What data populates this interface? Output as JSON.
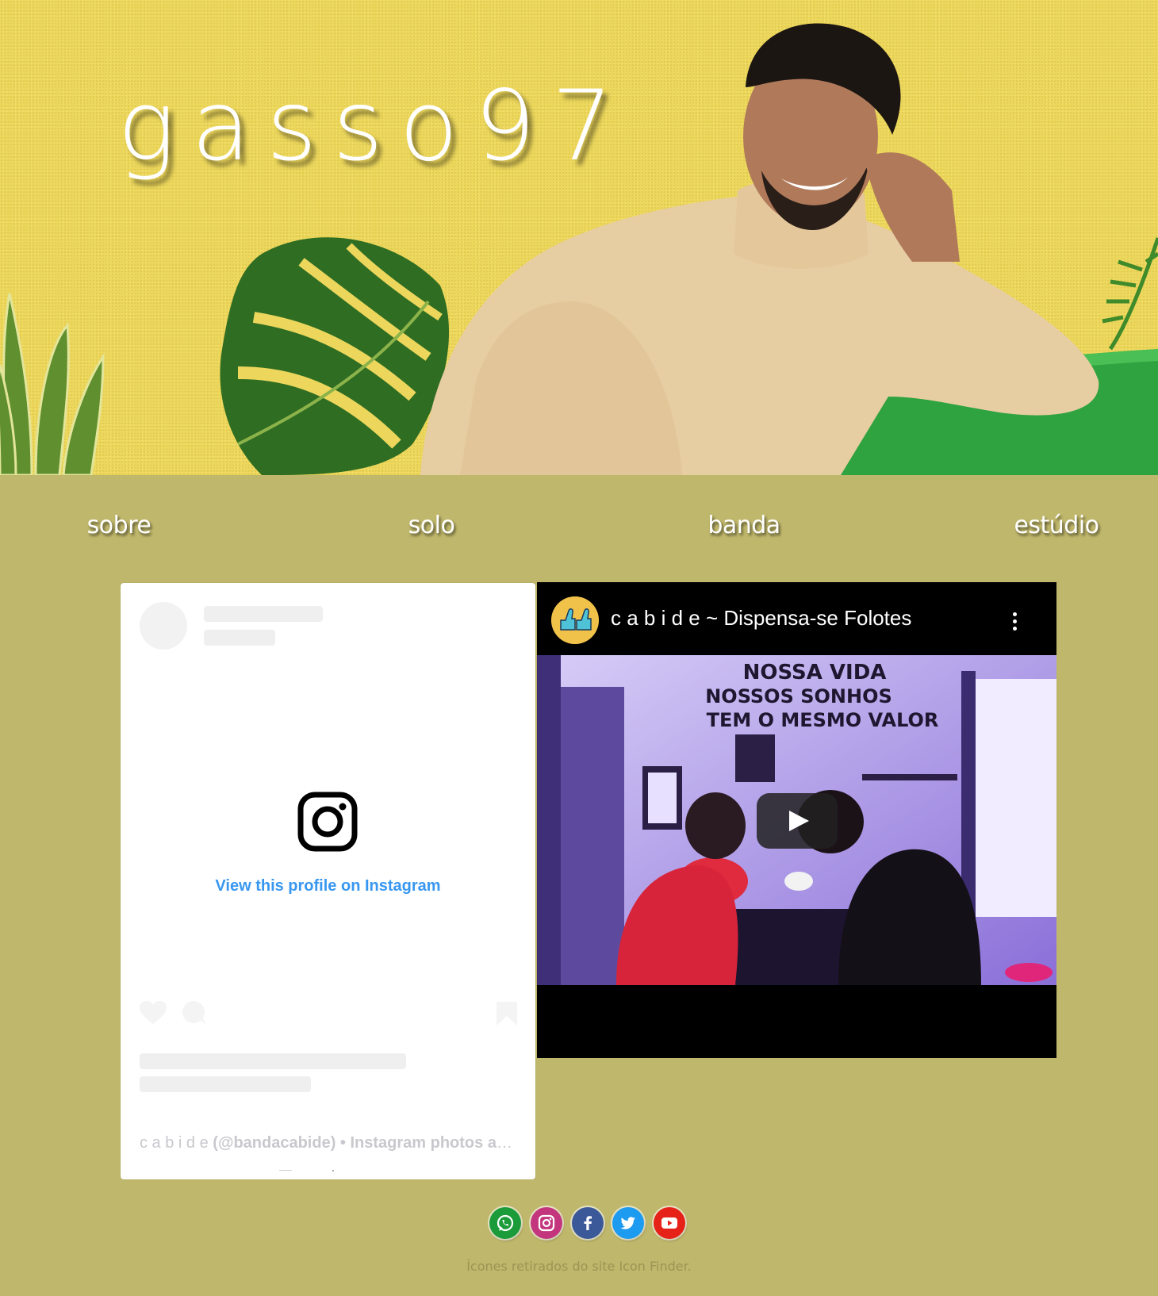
{
  "hero": {
    "title": "gasso97"
  },
  "nav": [
    {
      "label": "sobre"
    },
    {
      "label": "solo"
    },
    {
      "label": "banda"
    },
    {
      "label": "estúdio"
    }
  ],
  "instagram_embed": {
    "view_link": "View this profile on Instagram",
    "footer_name": "c a b i d e",
    "footer_handle": "(@bandacabide)",
    "footer_rest": "• Instagram photos and videos"
  },
  "youtube_embed": {
    "title": "c a b i d e ~ Dispensa-se Folotes",
    "thumbnail_text": [
      "NOSSA VIDA",
      "NOSSOS SONHOS",
      "TEM O MESMO VALOR"
    ]
  },
  "social": [
    {
      "icon": "whatsapp-icon",
      "color": "#1c9b3a"
    },
    {
      "icon": "instagram-icon",
      "color": "#c3367d"
    },
    {
      "icon": "facebook-icon",
      "color": "#3b5998"
    },
    {
      "icon": "twitter-icon",
      "color": "#1d9bf0"
    },
    {
      "icon": "youtube-icon",
      "color": "#e62117"
    }
  ],
  "credit": "Ícones retirados do site Icon Finder.",
  "colors": {
    "page_bg": "#bfb76b",
    "hero_bg": "#ecd75c",
    "link_blue": "#3897f0"
  }
}
